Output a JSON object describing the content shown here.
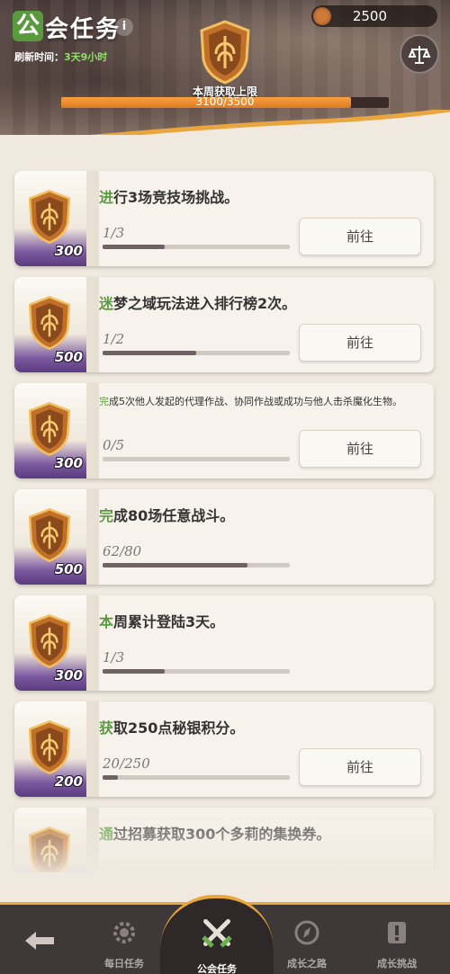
{
  "header": {
    "title_first_char": "公",
    "title_rest": "会任务",
    "info_icon": "i",
    "refresh_label": "刷新时间：",
    "refresh_value": "3天9小时",
    "currency_amount": "2500",
    "currency_icon": "guild-coin-icon",
    "balance_icon": "scale-icon",
    "weekly_label": "本周获取上限",
    "weekly_text": "3100/3500",
    "weekly_current": 3100,
    "weekly_max": 3500,
    "accent_color": "#e07a20"
  },
  "tasks": [
    {
      "hl": "进",
      "rest": "行3场竞技场挑战。",
      "small": false,
      "progress_text": "1/3",
      "current": 1,
      "total": 3,
      "reward": "300",
      "button": "前往"
    },
    {
      "hl": "迷",
      "rest": "梦之域玩法进入排行榜2次。",
      "small": false,
      "progress_text": "1/2",
      "current": 1,
      "total": 2,
      "reward": "500",
      "button": "前往"
    },
    {
      "hl": "完",
      "rest": "成5次他人发起的代理作战、协同作战或成功与他人击杀魔化生物。",
      "small": true,
      "progress_text": "0/5",
      "current": 0,
      "total": 5,
      "reward": "300",
      "button": "前往"
    },
    {
      "hl": "完",
      "rest": "成80场任意战斗。",
      "small": false,
      "progress_text": "62/80",
      "current": 62,
      "total": 80,
      "reward": "500",
      "button": ""
    },
    {
      "hl": "本",
      "rest": "周累计登陆3天。",
      "small": false,
      "progress_text": "1/3",
      "current": 1,
      "total": 3,
      "reward": "300",
      "button": ""
    },
    {
      "hl": "获",
      "rest": "取250点秘银积分。",
      "small": false,
      "progress_text": "20/250",
      "current": 20,
      "total": 250,
      "reward": "200",
      "button": "前往"
    },
    {
      "hl": "通",
      "rest": "过招募获取300个多莉的集换券。",
      "small": false,
      "progress_text": "",
      "current": 0,
      "total": 300,
      "reward": "",
      "button": ""
    }
  ],
  "nav": {
    "back_icon": "back-arrow-icon",
    "tabs": [
      {
        "label": "每日任务",
        "icon": "gear-icon"
      },
      {
        "label": "公会任务",
        "icon": "crossed-swords-icon"
      },
      {
        "label": "成长之路",
        "icon": "compass-icon"
      },
      {
        "label": "成长挑战",
        "icon": "warning-icon"
      }
    ]
  }
}
